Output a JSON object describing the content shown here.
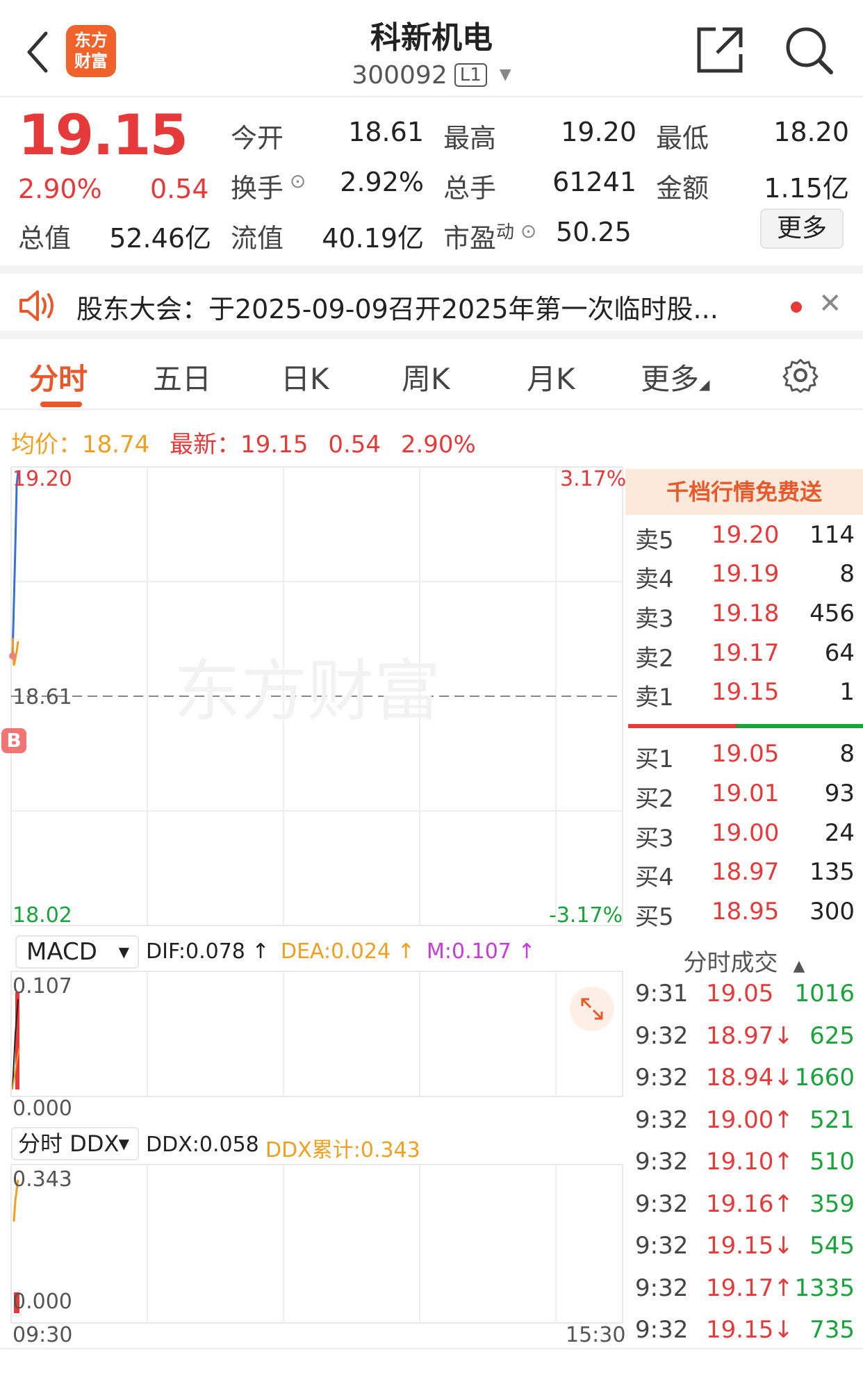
{
  "header": {
    "back_label": "返回",
    "logo_line1": "东方",
    "logo_line2": "财富",
    "stock_name": "科新机电",
    "stock_code": "300092",
    "level_badge": "L1"
  },
  "quote": {
    "price": "19.15",
    "change_pct": "2.90%",
    "change_amt": "0.54",
    "fields": {
      "open_label": "今开",
      "open_value": "18.61",
      "high_label": "最高",
      "high_value": "19.20",
      "low_label": "最低",
      "low_value": "18.20",
      "turnover_label": "换手",
      "turnover_value": "2.92%",
      "volume_label": "总手",
      "volume_value": "61241",
      "amount_label": "金额",
      "amount_value": "1.15亿",
      "mktcap_label": "总值",
      "mktcap_value": "52.46亿",
      "float_label": "流值",
      "float_value": "40.19亿",
      "pe_label": "市盈",
      "pe_sup": "动",
      "pe_value": "50.25"
    },
    "more_label": "更多"
  },
  "announcement": {
    "text": "股东大会：于2025-09-09召开2025年第一次临时股..."
  },
  "tabs": [
    {
      "label": "分时",
      "active": true
    },
    {
      "label": "五日"
    },
    {
      "label": "日K"
    },
    {
      "label": "周K"
    },
    {
      "label": "月K"
    },
    {
      "label": "更多"
    }
  ],
  "info_line": {
    "avg_label": "均价：",
    "avg_value": "18.74",
    "latest_label": "最新：",
    "latest_value": "19.15",
    "chg": "0.54",
    "chg_pct": "2.90%"
  },
  "chart": {
    "y_top": "19.20",
    "y_mid": "18.61",
    "y_bottom": "18.02",
    "pct_top": "3.17%",
    "pct_bottom": "-3.17%",
    "watermark": "东方财富",
    "b_marker": "B",
    "time_start": "09:30",
    "time_end": "15:30"
  },
  "macd": {
    "selector": "MACD",
    "dif": "DIF:0.078 ↑",
    "dea": "DEA:0.024 ↑",
    "m": "M:0.107 ↑",
    "y_top": "0.107",
    "y_bottom": "0.000"
  },
  "ddx": {
    "selector": "分时 DDX",
    "ddx": "DDX:0.058",
    "ddx_cum": "DDX累计:0.343",
    "y_top": "0.343",
    "y_bottom": "0.000"
  },
  "order_book": {
    "promo": "千档行情免费送",
    "asks": [
      {
        "label": "卖5",
        "price": "19.20",
        "vol": "114"
      },
      {
        "label": "卖4",
        "price": "19.19",
        "vol": "8"
      },
      {
        "label": "卖3",
        "price": "19.18",
        "vol": "456"
      },
      {
        "label": "卖2",
        "price": "19.17",
        "vol": "64"
      },
      {
        "label": "卖1",
        "price": "19.15",
        "vol": "1"
      }
    ],
    "bids": [
      {
        "label": "买1",
        "price": "19.05",
        "vol": "8"
      },
      {
        "label": "买2",
        "price": "19.01",
        "vol": "93"
      },
      {
        "label": "买3",
        "price": "19.00",
        "vol": "24"
      },
      {
        "label": "买4",
        "price": "18.97",
        "vol": "135"
      },
      {
        "label": "买5",
        "price": "18.95",
        "vol": "300"
      }
    ]
  },
  "ticks": {
    "header": "分时成交",
    "rows": [
      {
        "time": "9:31",
        "price": "19.05",
        "vol": "1016",
        "dir": "up"
      },
      {
        "time": "9:32",
        "price": "18.97↓",
        "vol": "625",
        "dir": "down"
      },
      {
        "time": "9:32",
        "price": "18.94↓",
        "vol": "1660",
        "dir": "down"
      },
      {
        "time": "9:32",
        "price": "19.00↑",
        "vol": "521",
        "dir": "up"
      },
      {
        "time": "9:32",
        "price": "19.10↑",
        "vol": "510",
        "dir": "up"
      },
      {
        "time": "9:32",
        "price": "19.16↑",
        "vol": "359",
        "dir": "up"
      },
      {
        "time": "9:32",
        "price": "19.15↓",
        "vol": "545",
        "dir": "down"
      },
      {
        "time": "9:32",
        "price": "19.17↑",
        "vol": "1335",
        "dir": "up"
      },
      {
        "time": "9:32",
        "price": "19.15↓",
        "vol": "735",
        "dir": "down"
      }
    ]
  },
  "colors": {
    "up": "#e63a3a",
    "down": "#19a33a",
    "accent": "#e8582a",
    "avg_line": "#f0a020",
    "price_line": "#3a6fd8"
  }
}
